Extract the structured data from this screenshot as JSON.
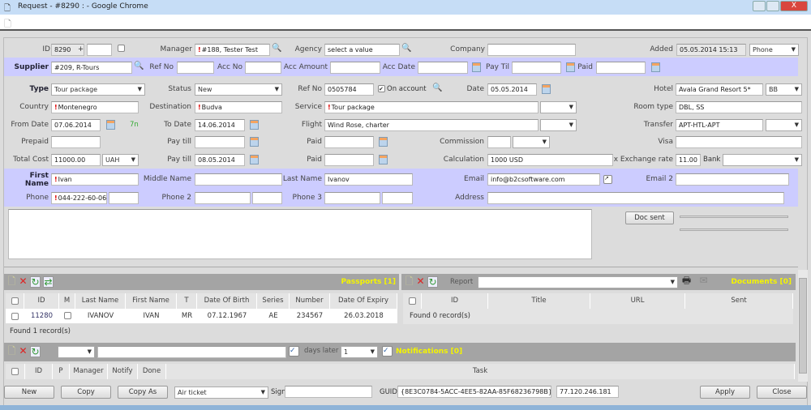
{
  "window": {
    "title": "Request - #8290 : - Google Chrome",
    "close": "X"
  },
  "form": {
    "id": {
      "label": "ID",
      "value": "8290",
      "plus": "+"
    },
    "manager": {
      "label": "Manager",
      "value": "#188, Tester Test"
    },
    "agency": {
      "label": "Agency",
      "value": "select a value"
    },
    "company": {
      "label": "Company",
      "value": ""
    },
    "added": {
      "label": "Added",
      "value": "05.05.2014 15:13",
      "source": "Phone"
    },
    "supplier": {
      "label": "Supplier",
      "value": "#209, R-Tours"
    },
    "supplier_ref_no": {
      "label": "Ref No",
      "value": ""
    },
    "acc_no": {
      "label": "Acc No",
      "value": ""
    },
    "acc_amount": {
      "label": "Acc Amount",
      "value": ""
    },
    "acc_date": {
      "label": "Acc Date",
      "value": ""
    },
    "supplier_pay_till": {
      "label": "Pay Til",
      "value": ""
    },
    "supplier_paid": {
      "label": "Paid",
      "value": ""
    },
    "type": {
      "label": "Type",
      "value": "Tour package"
    },
    "status": {
      "label": "Status",
      "value": "New"
    },
    "ref_no": {
      "label": "Ref No",
      "value": "0505784"
    },
    "on_account": {
      "label": "On account",
      "checked": true
    },
    "date": {
      "label": "Date",
      "value": "05.05.2014"
    },
    "hotel": {
      "label": "Hotel",
      "value": "Avala Grand Resort 5*",
      "board": "BB"
    },
    "country": {
      "label": "Country",
      "value": "Montenegro"
    },
    "destination": {
      "label": "Destination",
      "value": "Budva"
    },
    "service": {
      "label": "Service",
      "value": "Tour package",
      "option": ""
    },
    "room_type": {
      "label": "Room type",
      "value": "DBL, SS"
    },
    "from_date": {
      "label": "From Date",
      "value": "07.06.2014",
      "nights": "7n"
    },
    "to_date": {
      "label": "To Date",
      "value": "14.06.2014"
    },
    "flight": {
      "label": "Flight",
      "value": "Wind Rose, charter",
      "option": ""
    },
    "transfer": {
      "label": "Transfer",
      "value": "APT-HTL-APT",
      "option": ""
    },
    "prepaid": {
      "label": "Prepaid",
      "value": ""
    },
    "pay_till_1": {
      "label": "Pay till",
      "value": ""
    },
    "paid_1": {
      "label": "Paid",
      "value": ""
    },
    "commission": {
      "label": "Commission",
      "value": "",
      "option": ""
    },
    "visa": {
      "label": "Visa",
      "value": ""
    },
    "total_cost": {
      "label": "Total Cost",
      "value": "11000.00",
      "currency": "UAH"
    },
    "pay_till_2": {
      "label": "Pay till",
      "value": "08.05.2014"
    },
    "paid_2": {
      "label": "Paid",
      "value": ""
    },
    "calculation": {
      "label": "Calculation",
      "value": "1000 USD"
    },
    "exchange_rate": {
      "label": "x Exchange rate",
      "value": "11.00"
    },
    "bank": {
      "label": "Bank",
      "value": ""
    },
    "first_name": {
      "label": "First Name",
      "value": "Ivan"
    },
    "middle_name": {
      "label": "Middle Name",
      "value": ""
    },
    "last_name": {
      "label": "Last Name",
      "value": "Ivanov"
    },
    "email": {
      "label": "Email",
      "value": "info@b2csoftware.com"
    },
    "email2": {
      "label": "Email 2",
      "value": ""
    },
    "phone": {
      "label": "Phone",
      "value": "044-222-60-06",
      "ext": ""
    },
    "phone2": {
      "label": "Phone 2",
      "value": "",
      "ext": ""
    },
    "phone3": {
      "label": "Phone 3",
      "value": "",
      "ext": ""
    },
    "address": {
      "label": "Address",
      "value": ""
    },
    "notes": "",
    "doc_sent": "Doc sent"
  },
  "passports": {
    "title": "Passports [1]",
    "columns": [
      "",
      "ID",
      "M",
      "Last Name",
      "First Name",
      "T",
      "Date Of Birth",
      "Series",
      "Number",
      "Date Of Expiry"
    ],
    "rows": [
      {
        "id": "11280",
        "m": "",
        "last": "IVANOV",
        "first": "IVAN",
        "t": "MR",
        "dob": "07.12.1967",
        "series": "AE",
        "number": "234567",
        "expiry": "26.03.2018"
      }
    ],
    "footer": "Found 1 record(s)"
  },
  "documents": {
    "title": "Documents [0]",
    "report_label": "Report",
    "report_value": "",
    "columns": [
      "",
      "ID",
      "Title",
      "URL",
      "Sent"
    ],
    "footer": "Found 0 record(s)"
  },
  "notifications": {
    "title": "Notifications [0]",
    "type_value": "",
    "text_value": "",
    "days_label": "days later",
    "days_value": "1",
    "columns": [
      "",
      "ID",
      "P",
      "Manager",
      "Notify",
      "Done",
      "Task"
    ]
  },
  "footer": {
    "new": "New",
    "copy": "Copy",
    "copy_as": "Copy As",
    "copy_as_type": "Air ticket",
    "sign_label": "Sign",
    "sign_value": "",
    "guid_label": "GUID",
    "guid_value": "{8E3C0784-5ACC-4EE5-82AA-85F68236798B}",
    "ip": "77.120.246.181",
    "apply": "Apply",
    "close": "Close"
  }
}
